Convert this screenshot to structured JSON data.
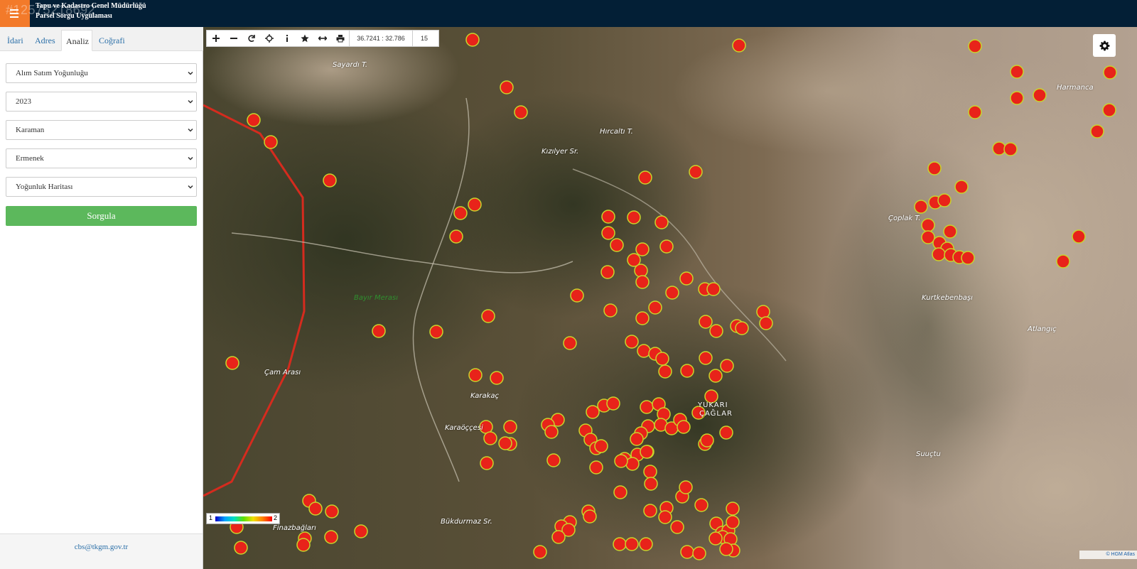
{
  "header": {
    "watermark": "#12575218692",
    "title_line1": "Tapu ve Kadastro Genel Müdürlüğü",
    "title_line2": "Parsel Sorgu Uygulaması"
  },
  "sidebar": {
    "tabs": [
      {
        "label": "İdari"
      },
      {
        "label": "Adres"
      },
      {
        "label": "Analiz"
      },
      {
        "label": "Coğrafi"
      }
    ],
    "active_tab": "Analiz",
    "selects": [
      {
        "value": "Alım Satım Yoğunluğu"
      },
      {
        "value": "2023"
      },
      {
        "value": "Karaman"
      },
      {
        "value": "Ermenek"
      },
      {
        "value": "Yoğunluk Haritası"
      }
    ],
    "query_button": "Sorgula",
    "footer_email": "cbs@tkgm.gov.tr"
  },
  "map": {
    "coordinate": "36.7241 : 32.786",
    "zoom_level": "15",
    "legend_min": "1",
    "legend_max": "2",
    "attribution": "© HGM Atlas",
    "place_labels": [
      {
        "text": "Sayardı T."
      },
      {
        "text": "Hırcaltı T."
      },
      {
        "text": "Kızılyer Sr."
      },
      {
        "text": "Harmanca"
      },
      {
        "text": "Çoplak T."
      },
      {
        "text": "Kurtkebenbaşı"
      },
      {
        "text": "Atlangıç"
      },
      {
        "text": "Bayır Merası"
      },
      {
        "text": "Çam Arası"
      },
      {
        "text": "Karakaç"
      },
      {
        "text": "YUKARI"
      },
      {
        "text": "ÇAĞLAR"
      },
      {
        "text": "Karaöççesi"
      },
      {
        "text": "Suuçtu"
      },
      {
        "text": "Bükdurmaz Sr."
      },
      {
        "text": "Finazbağları"
      }
    ],
    "density_color": "#e8231a",
    "density_outline": "#c8d42c",
    "border_color": "#d52b1e"
  }
}
